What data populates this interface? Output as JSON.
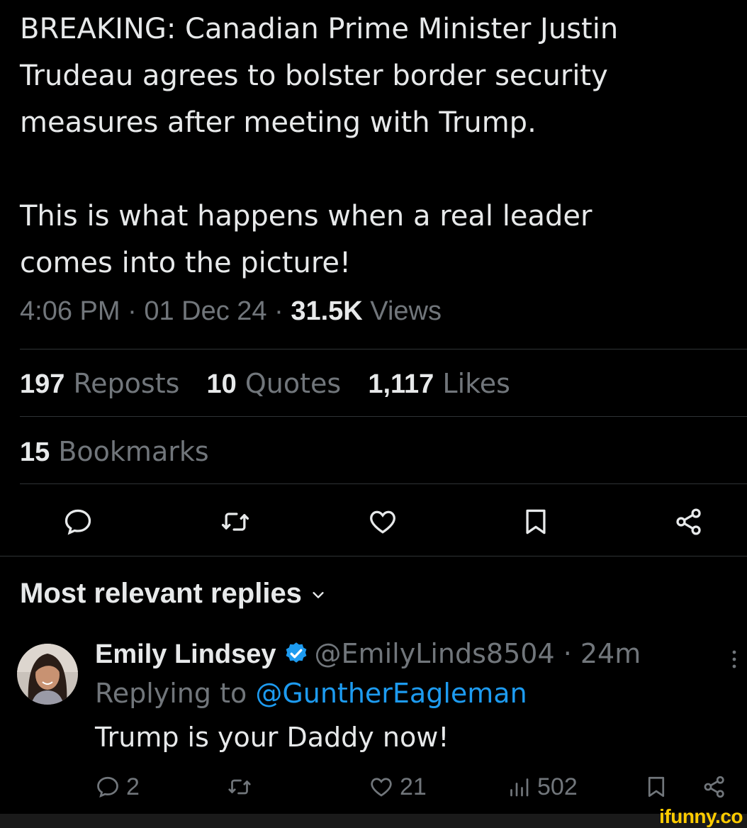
{
  "tweet": {
    "line1": "BREAKING: Canadian Prime Minister Justin",
    "line2": "Trudeau agrees to bolster border security",
    "line3": "measures after meeting with Trump.",
    "line4": "This is what happens when a real leader",
    "line5": "comes into the picture!",
    "time": "4:06 PM",
    "sep1": " · ",
    "date": "01 Dec 24",
    "sep2": " · ",
    "views_count": "31.5K",
    "views_label": " Views"
  },
  "stats": {
    "reposts_count": "197",
    "reposts_label": " Reposts",
    "quotes_count": "10",
    "quotes_label": " Quotes",
    "likes_count": "1,117",
    "likes_label": " Likes",
    "bookmarks_count": "15",
    "bookmarks_label": " Bookmarks"
  },
  "actions": [
    "reply-icon",
    "repost-icon",
    "like-icon",
    "bookmark-icon",
    "share-icon"
  ],
  "replies_section": {
    "title": "Most relevant replies"
  },
  "reply": {
    "name": "Emily Lindsey",
    "handle": "@EmilyLinds8504",
    "sep": " · ",
    "time": "24m",
    "replying_prefix": "Replying to ",
    "replying_to": "@GuntherEagleman",
    "text": "Trump is your Daddy now!",
    "reply_count": "2",
    "like_count": "21",
    "view_count": "502"
  },
  "watermark": "ifunny.co",
  "colors": {
    "background": "#000000",
    "text": "#e7e9ea",
    "muted": "#71767b",
    "link": "#1d9bf0",
    "divider": "#2f3336",
    "verified": "#1d9bf0",
    "watermark": "#ffcc00"
  }
}
